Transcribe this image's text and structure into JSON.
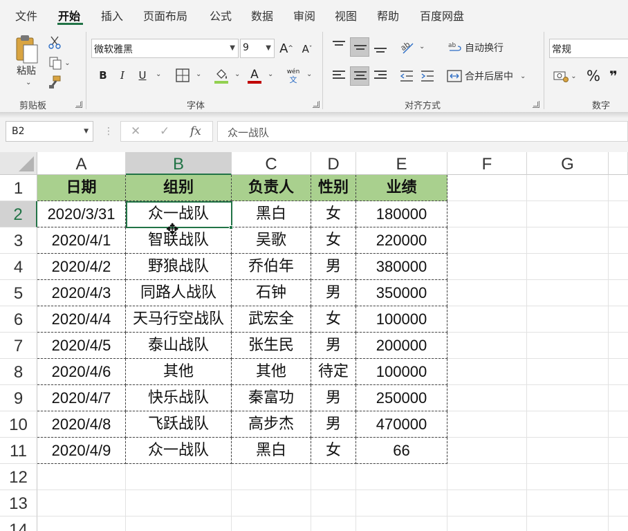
{
  "menu": {
    "tabs": [
      "文件",
      "开始",
      "插入",
      "页面布局",
      "公式",
      "数据",
      "审阅",
      "视图",
      "帮助",
      "百度网盘"
    ],
    "active": "开始"
  },
  "ribbon": {
    "clipboard": {
      "paste_label": "粘贴",
      "group_label": "剪贴板"
    },
    "font": {
      "font_name": "微软雅黑",
      "font_size": "9",
      "bold": "B",
      "italic": "I",
      "underline": "U",
      "phonetic_top": "wén",
      "phonetic_bottom": "文",
      "font_color_letter": "A",
      "fill_color": "#92d050",
      "font_color": "#c00000",
      "group_label": "字体"
    },
    "alignment": {
      "wrap_text": "自动换行",
      "merge_center": "合并后居中",
      "group_label": "对齐方式"
    },
    "number": {
      "format": "常规",
      "percent": "%",
      "comma": "❞",
      "group_label": "数字"
    }
  },
  "formula_bar": {
    "name_box": "B2",
    "cancel": "✕",
    "enter": "✓",
    "fx": "fx",
    "content": "众一战队"
  },
  "sheet": {
    "columns": [
      "A",
      "B",
      "C",
      "D",
      "E",
      "F",
      "G"
    ],
    "rows": [
      "1",
      "2",
      "3",
      "4",
      "5",
      "6",
      "7",
      "8",
      "9",
      "10",
      "11",
      "12",
      "13",
      "14"
    ],
    "header": [
      "日期",
      "组别",
      "负责人",
      "性别",
      "业绩"
    ],
    "data": [
      [
        "2020/3/31",
        "众一战队",
        "黑白",
        "女",
        "180000"
      ],
      [
        "2020/4/1",
        "智联战队",
        "吴歌",
        "女",
        "220000"
      ],
      [
        "2020/4/2",
        "野狼战队",
        "乔伯年",
        "男",
        "380000"
      ],
      [
        "2020/4/3",
        "同路人战队",
        "石钟",
        "男",
        "350000"
      ],
      [
        "2020/4/4",
        "天马行空战队",
        "武宏全",
        "女",
        "100000"
      ],
      [
        "2020/4/5",
        "泰山战队",
        "张生民",
        "男",
        "200000"
      ],
      [
        "2020/4/6",
        "其他",
        "其他",
        "待定",
        "100000"
      ],
      [
        "2020/4/7",
        "快乐战队",
        "秦富功",
        "男",
        "250000"
      ],
      [
        "2020/4/8",
        "飞跃战队",
        "高步杰",
        "男",
        "470000"
      ],
      [
        "2020/4/9",
        "众一战队",
        "黑白",
        "女",
        "66"
      ]
    ],
    "header_fill": "#a9d08e",
    "accent": "#217346"
  }
}
